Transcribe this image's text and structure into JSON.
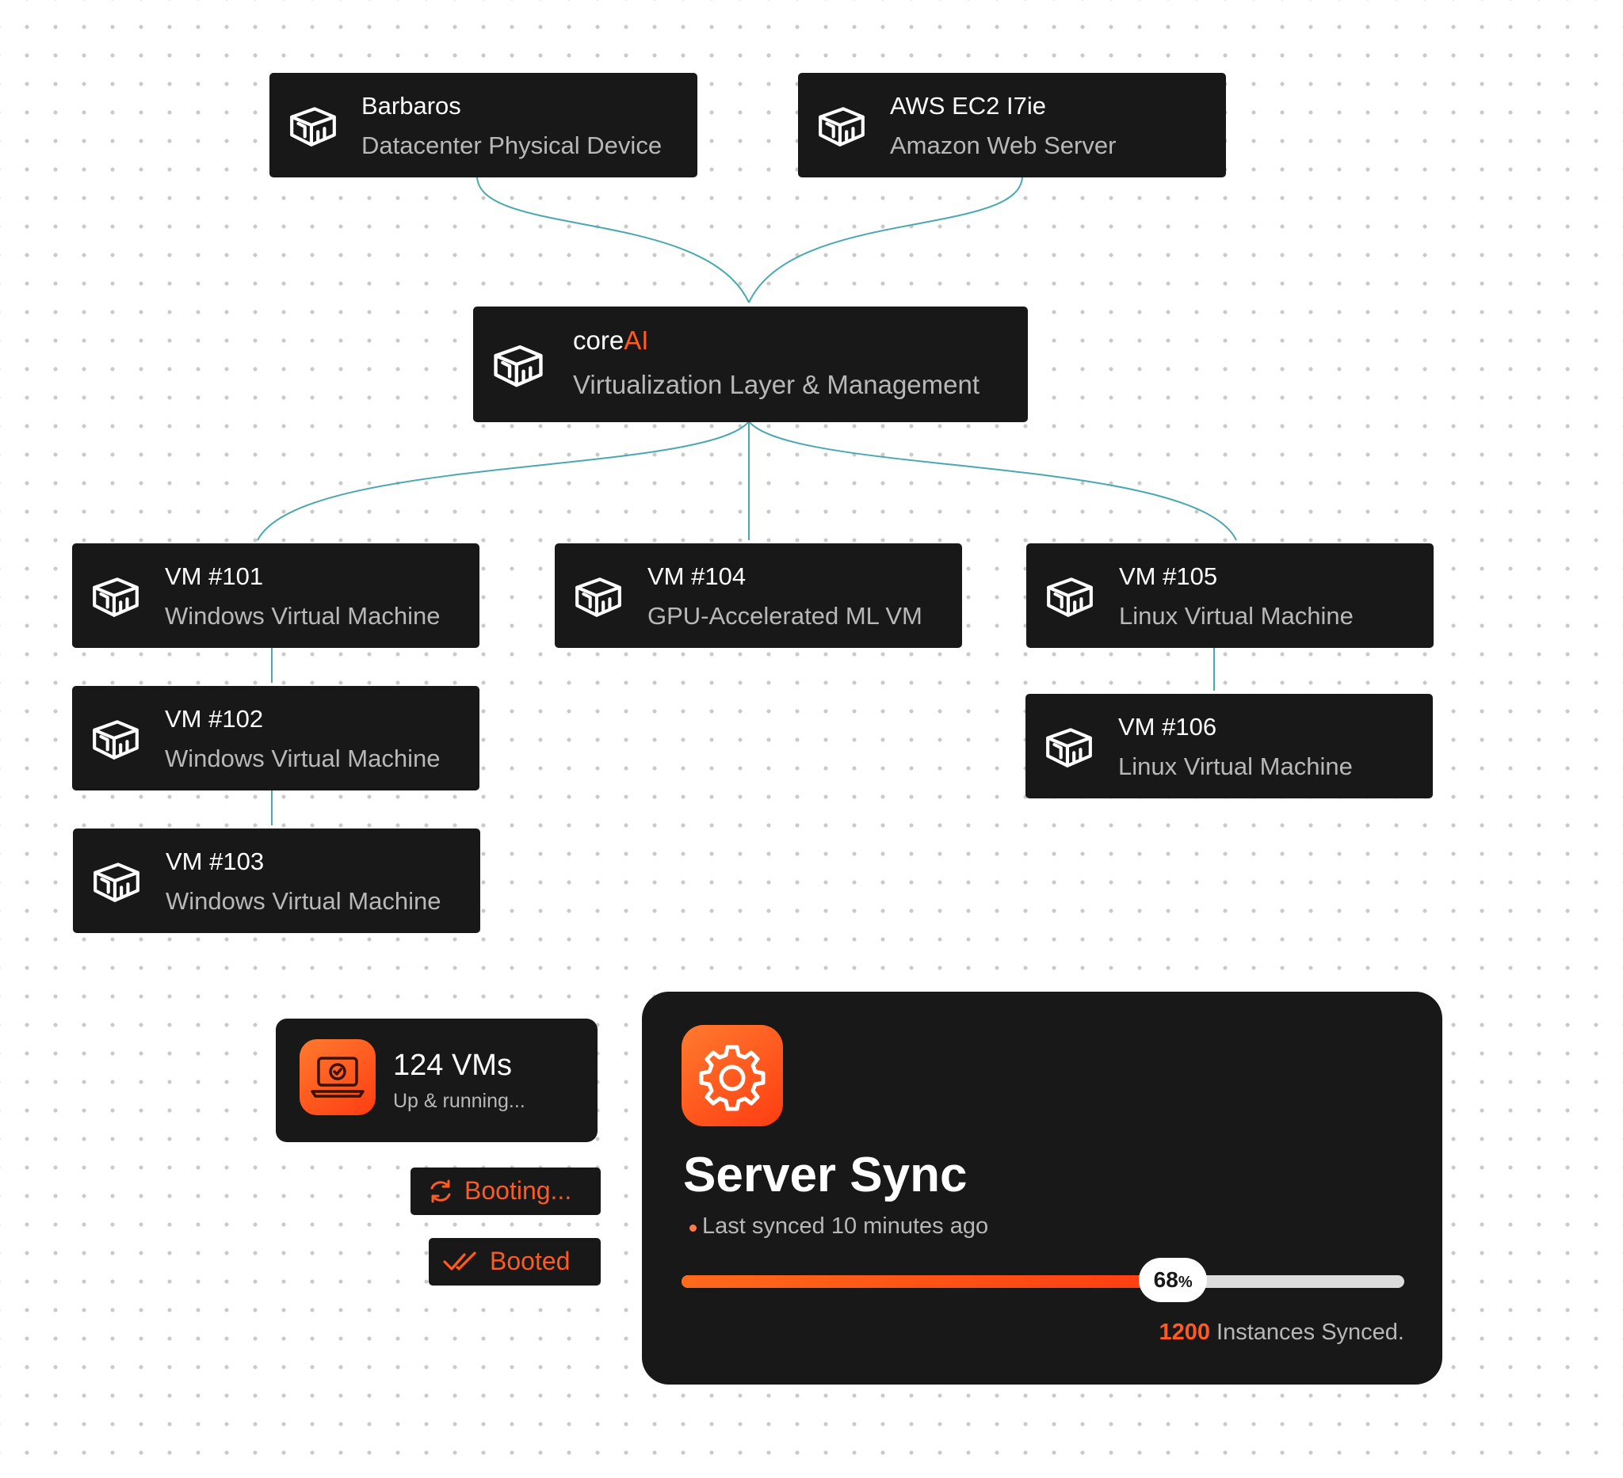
{
  "nodes": {
    "barbaros": {
      "title": "Barbaros",
      "subtitle": "Datacenter Physical Device"
    },
    "aws": {
      "title": "AWS EC2 I7ie",
      "subtitle": "Amazon Web Server"
    },
    "coreai": {
      "title_part1": "core",
      "title_part2": "AI",
      "subtitle": "Virtualization Layer & Management"
    },
    "vm101": {
      "title": "VM #101",
      "subtitle": "Windows Virtual Machine"
    },
    "vm102": {
      "title": "VM #102",
      "subtitle": "Windows Virtual Machine"
    },
    "vm103": {
      "title": "VM #103",
      "subtitle": "Windows Virtual Machine"
    },
    "vm104": {
      "title": "VM #104",
      "subtitle": "GPU-Accelerated ML VM"
    },
    "vm105": {
      "title": "VM #105",
      "subtitle": "Linux Virtual Machine"
    },
    "vm106": {
      "title": "VM #106",
      "subtitle": "Linux Virtual Machine"
    }
  },
  "status_card": {
    "title": "124 VMs",
    "subtitle": "Up & running..."
  },
  "pills": {
    "booting": "Booting...",
    "booted": "Booted"
  },
  "sync_card": {
    "title": "Server Sync",
    "last_synced": "Last synced 10 minutes ago",
    "progress_value": "68",
    "progress_unit": "%",
    "progress_fraction": 0.68,
    "instances_count": "1200",
    "instances_label": "Instances Synced."
  },
  "colors": {
    "accent": "#ff5a1f",
    "connector": "#4aa8b0",
    "card": "#181818"
  }
}
